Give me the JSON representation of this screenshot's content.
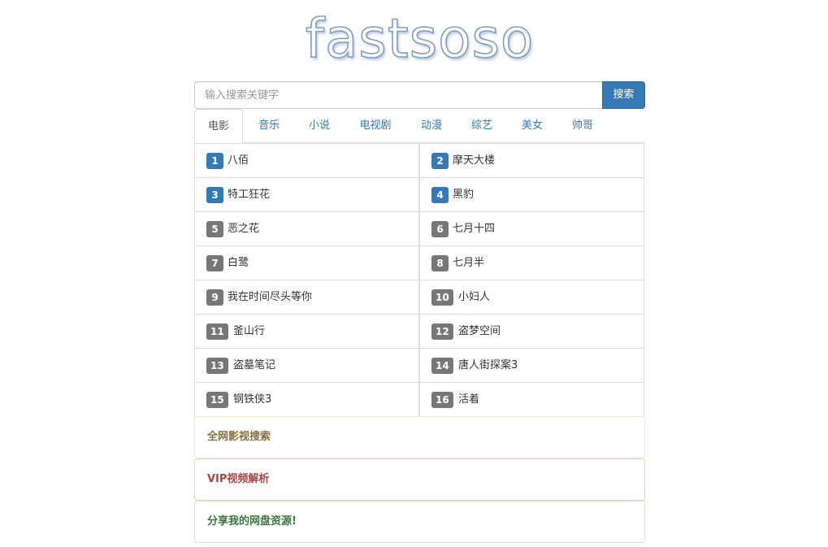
{
  "logo": {
    "text": "fastsoso"
  },
  "search": {
    "placeholder": "输入搜索关键字",
    "button_label": "搜索"
  },
  "tabs": [
    {
      "label": "电影",
      "active": true
    },
    {
      "label": "音乐",
      "active": false
    },
    {
      "label": "小说",
      "active": false
    },
    {
      "label": "电视剧",
      "active": false
    },
    {
      "label": "动漫",
      "active": false
    },
    {
      "label": "综艺",
      "active": false
    },
    {
      "label": "美女",
      "active": false
    },
    {
      "label": "帅哥",
      "active": false
    }
  ],
  "ranking": [
    {
      "rank": "1",
      "title": "八佰"
    },
    {
      "rank": "2",
      "title": "摩天大楼"
    },
    {
      "rank": "3",
      "title": "特工狂花"
    },
    {
      "rank": "4",
      "title": "黑豹"
    },
    {
      "rank": "5",
      "title": "恶之花"
    },
    {
      "rank": "6",
      "title": "七月十四"
    },
    {
      "rank": "7",
      "title": "白鹭"
    },
    {
      "rank": "8",
      "title": "七月半"
    },
    {
      "rank": "9",
      "title": "我在时间尽头等你"
    },
    {
      "rank": "10",
      "title": "小妇人"
    },
    {
      "rank": "11",
      "title": "釜山行"
    },
    {
      "rank": "12",
      "title": "盗梦空间"
    },
    {
      "rank": "13",
      "title": "盗墓笔记"
    },
    {
      "rank": "14",
      "title": "唐人街探案3"
    },
    {
      "rank": "15",
      "title": "钢铁侠3"
    },
    {
      "rank": "16",
      "title": "活着"
    }
  ],
  "panels": [
    {
      "label": "全网影视搜索",
      "color": "#8a6d3b",
      "border": "#faebcc"
    },
    {
      "label": "VIP视频解析",
      "color": "#a94442",
      "border": "#ebccd1"
    },
    {
      "label": "分享我的网盘资源!",
      "color": "#3c763d",
      "border": "#d6e9c6"
    }
  ],
  "colors": {
    "primary": "#337ab7",
    "badge_top": "#337ab7",
    "badge_default": "#777777"
  }
}
